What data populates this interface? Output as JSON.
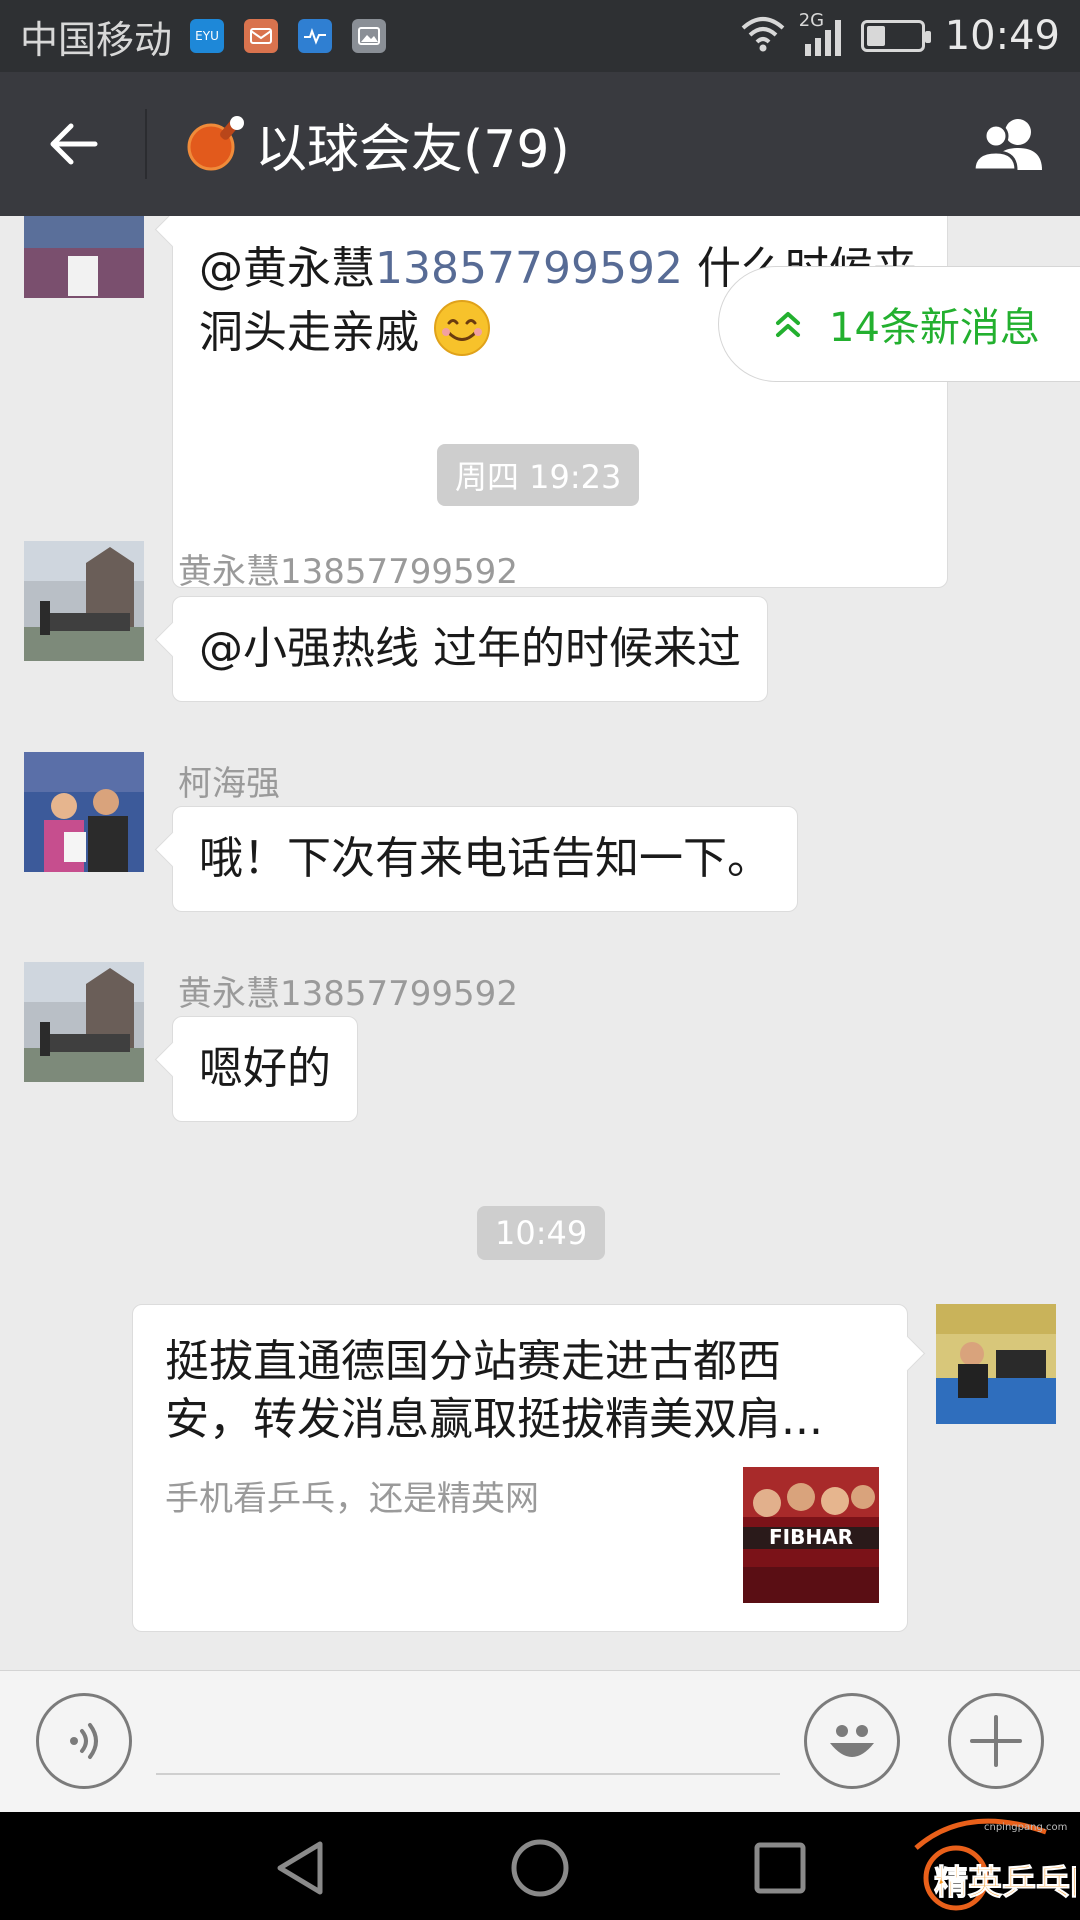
{
  "status_bar": {
    "carrier": "中国移动",
    "notification_icons": [
      "eyu-app-icon",
      "mail-icon",
      "health-icon",
      "gallery-icon"
    ],
    "network": "2G",
    "battery_level": 0.35,
    "time": "10:49"
  },
  "header": {
    "title": "以球会友(79)",
    "group_icon": "ping-pong-paddle-icon"
  },
  "new_messages_banner": {
    "label": "14条新消息",
    "color": "#23b02f"
  },
  "messages": [
    {
      "type": "text",
      "side": "left",
      "sender": "",
      "mention": "@黄永慧",
      "mention_number": "13857799592",
      "text_after": " 什么时候来洞头走亲戚",
      "emoji": "smiley-emoji"
    },
    {
      "type": "timestamp",
      "text": "周四 19:23"
    },
    {
      "type": "text",
      "side": "left",
      "sender": "黄永慧13857799592",
      "text": "@小强热线 过年的时候来过"
    },
    {
      "type": "text",
      "side": "left",
      "sender": "柯海强",
      "text": "哦！下次有来电话告知一下。"
    },
    {
      "type": "text",
      "side": "left",
      "sender": "黄永慧13857799592",
      "text": "嗯好的"
    },
    {
      "type": "timestamp",
      "text": "10:49"
    },
    {
      "type": "link",
      "side": "right",
      "title": "挺拔直通德国分站赛走进古都西安，转发消息赢取挺拔精美双肩...",
      "description": "手机看乒乓，还是精英网",
      "thumb_text": "FIBHAR"
    }
  ],
  "input_bar": {
    "placeholder": "",
    "voice_icon": "voice-toggle-icon",
    "emoji_icon": "emoji-icon",
    "more_icon": "plus-icon"
  },
  "nav_bar": {
    "buttons": [
      "back-triangle-icon",
      "home-circle-icon",
      "recents-square-icon"
    ]
  },
  "watermark": {
    "brand": "精英乒乓网",
    "url": "cnpingpang.com"
  },
  "colors": {
    "header_bg": "#393a3f",
    "status_bg": "#2e3033",
    "chat_bg": "#ebebeb",
    "link_blue": "#576b95"
  }
}
